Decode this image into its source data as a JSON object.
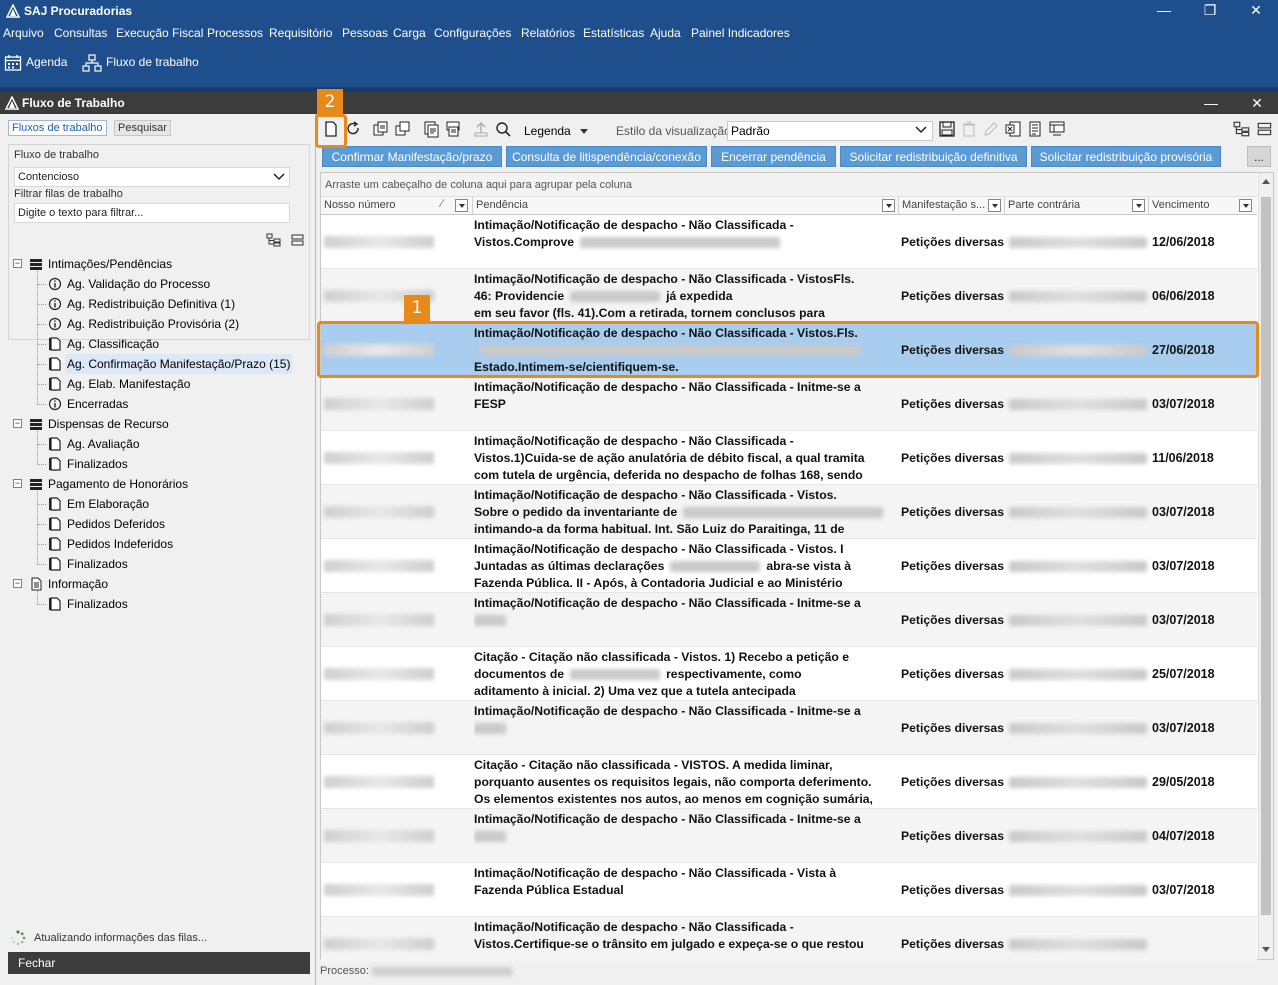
{
  "app": {
    "title": "SAJ Procuradorias",
    "menu": [
      "Arquivo",
      "Consultas",
      "Execução Fiscal",
      "Processos",
      "Requisitório",
      "Pessoas",
      "Carga",
      "Configurações",
      "Relatórios",
      "Estatísticas",
      "Ajuda",
      "Painel Indicadores"
    ],
    "quick": {
      "agenda": "Agenda",
      "fluxo": "Fluxo de trabalho"
    }
  },
  "window": {
    "title": "Fluxo de Trabalho"
  },
  "left": {
    "tabs": {
      "flows": "Fluxos de trabalho",
      "search": "Pesquisar"
    },
    "flow_label": "Fluxo de trabalho",
    "flow_value": "Contencioso",
    "filter_label": "Filtrar filas de trabalho",
    "filter_placeholder": "Digite o texto para filtrar...",
    "tree": [
      {
        "label": "Intimações/Pendências",
        "level": 0,
        "icon": "group"
      },
      {
        "label": "Ag. Validação do Processo",
        "level": 1,
        "icon": "info"
      },
      {
        "label": "Ag. Redistribuição Definitiva (1)",
        "level": 1,
        "icon": "info"
      },
      {
        "label": "Ag. Redistribuição Provisória (2)",
        "level": 1,
        "icon": "info"
      },
      {
        "label": "Ag. Classificação",
        "level": 1,
        "icon": "doc"
      },
      {
        "label": "Ag. Confirmação Manifestação/Prazo (15)",
        "level": 1,
        "icon": "doc",
        "selected": true
      },
      {
        "label": "Ag. Elab. Manifestação",
        "level": 1,
        "icon": "doc"
      },
      {
        "label": "Encerradas",
        "level": 1,
        "icon": "info"
      },
      {
        "label": "Dispensas de Recurso",
        "level": 0,
        "icon": "group"
      },
      {
        "label": "Ag. Avaliação",
        "level": 1,
        "icon": "doc"
      },
      {
        "label": "Finalizados",
        "level": 1,
        "icon": "doc"
      },
      {
        "label": "Pagamento de Honorários",
        "level": 0,
        "icon": "group"
      },
      {
        "label": "Em Elaboração",
        "level": 1,
        "icon": "doc"
      },
      {
        "label": "Pedidos Deferidos",
        "level": 1,
        "icon": "doc"
      },
      {
        "label": "Pedidos Indeferidos",
        "level": 1,
        "icon": "doc"
      },
      {
        "label": "Finalizados",
        "level": 1,
        "icon": "doc"
      },
      {
        "label": "Informação",
        "level": 0,
        "icon": "page"
      },
      {
        "label": "Finalizados",
        "level": 1,
        "icon": "doc"
      }
    ],
    "loading": "Atualizando informações das filas...",
    "close_button": "Fechar"
  },
  "toolbar": {
    "legenda": "Legenda",
    "estilo_label": "Estilo da visualização",
    "estilo_value": "Padrão"
  },
  "actions": {
    "confirm": "Confirmar Manifestação/prazo",
    "consulta": "Consulta de litispendência/conexão",
    "encerrar": "Encerrar pendência",
    "redist_def": "Solicitar redistribuição definitiva",
    "redist_prov": "Solicitar redistribuição provisória",
    "more": "..."
  },
  "grid": {
    "group_hint": "Arraste um cabeçalho de coluna aqui para agrupar pela coluna",
    "columns": {
      "numero": "Nosso número",
      "pendencia": "Pendência",
      "manifestacao": "Manifestação s...",
      "parte": "Parte contrária",
      "vencimento": "Vencimento"
    },
    "rows": [
      {
        "lines": [
          "Intimação/Notificação de despacho - Não Classificada -",
          "Vistos.Comprove"
        ],
        "manifestacao": "Petições diversas",
        "vencimento": "12/06/2018"
      },
      {
        "lines": [
          "Intimação/Notificação de despacho - Não Classificada - VistosFls.",
          "46: Providencie",
          "em seu favor (fls. 41).Com a retirada, tornem conclusos para"
        ],
        "tail2": "já expedida",
        "manifestacao": "Petições diversas",
        "vencimento": "06/06/2018"
      },
      {
        "lines": [
          "Intimação/Notificação de despacho - Não Classificada - Vistos.Fls.",
          "",
          "Estado.Intimem-se/cientifiquem-se."
        ],
        "manifestacao": "Petições diversas",
        "vencimento": "27/06/2018",
        "selected": true
      },
      {
        "lines": [
          "Intimação/Notificação de despacho - Não Classificada - Initme-se a",
          "FESP"
        ],
        "manifestacao": "Petições diversas",
        "vencimento": "03/07/2018"
      },
      {
        "lines": [
          "Intimação/Notificação de despacho - Não Classificada -",
          "Vistos.1)Cuida-se de ação anulatória de débito fiscal, a qual tramita",
          "com tutela de urgência, deferida no despacho de folhas 168, sendo"
        ],
        "manifestacao": "Petições diversas",
        "vencimento": "11/06/2018"
      },
      {
        "lines": [
          "Intimação/Notificação de despacho - Não Classificada - Vistos.",
          "Sobre o pedido da inventariante de",
          "intimando-a da forma habitual. Int. São Luiz do Paraitinga, 11 de"
        ],
        "manifestacao": "Petições diversas",
        "vencimento": "03/07/2018"
      },
      {
        "lines": [
          "Intimação/Notificação de despacho - Não Classificada - Vistos. I",
          "Juntadas as últimas declarações",
          "Fazenda Pública. II - Após, à Contadoria Judicial e ao Ministério"
        ],
        "tail2": "abra-se vista à",
        "manifestacao": "Petições diversas",
        "vencimento": "03/07/2018"
      },
      {
        "lines": [
          "Intimação/Notificação de despacho - Não Classificada - Initme-se a"
        ],
        "manifestacao": "Petições diversas",
        "vencimento": "03/07/2018"
      },
      {
        "lines": [
          "Citação - Citação não classificada - Vistos. 1) Recebo a petição e",
          "documentos de",
          "aditamento à inicial. 2) Uma vez que a tutela antecipada"
        ],
        "tail2": "respectivamente, como",
        "manifestacao": "Petições diversas",
        "vencimento": "25/07/2018"
      },
      {
        "lines": [
          "Intimação/Notificação de despacho - Não Classificada - Initme-se a"
        ],
        "manifestacao": "Petições diversas",
        "vencimento": "03/07/2018"
      },
      {
        "lines": [
          "Citação - Citação não classificada - VISTOS. A medida liminar,",
          "porquanto ausentes os requisitos legais, não comporta deferimento.",
          "Os elementos existentes nos autos, ao menos em cognição sumária,"
        ],
        "manifestacao": "Petições diversas",
        "vencimento": "29/05/2018"
      },
      {
        "lines": [
          "Intimação/Notificação de despacho - Não Classificada - Initme-se a"
        ],
        "manifestacao": "Petições diversas",
        "vencimento": "04/07/2018"
      },
      {
        "lines": [
          "Intimação/Notificação de despacho - Não Classificada - Vista à",
          "Fazenda Pública Estadual"
        ],
        "manifestacao": "Petições diversas",
        "vencimento": "03/07/2018"
      },
      {
        "lines": [
          "Intimação/Notificação de despacho - Não Classificada -",
          "Vistos.Certifique-se o trânsito em julgado e expeça-se o que restou"
        ],
        "manifestacao": "Petições diversas",
        "vencimento": ""
      }
    ]
  },
  "status": {
    "processo_label": "Processo:"
  },
  "callouts": {
    "one": "1",
    "two": "2"
  },
  "colors": {
    "accent": "#1f4e8c",
    "button": "#5b9bd5",
    "selected_row": "#a9cdef",
    "callout": "#e88a1a"
  }
}
